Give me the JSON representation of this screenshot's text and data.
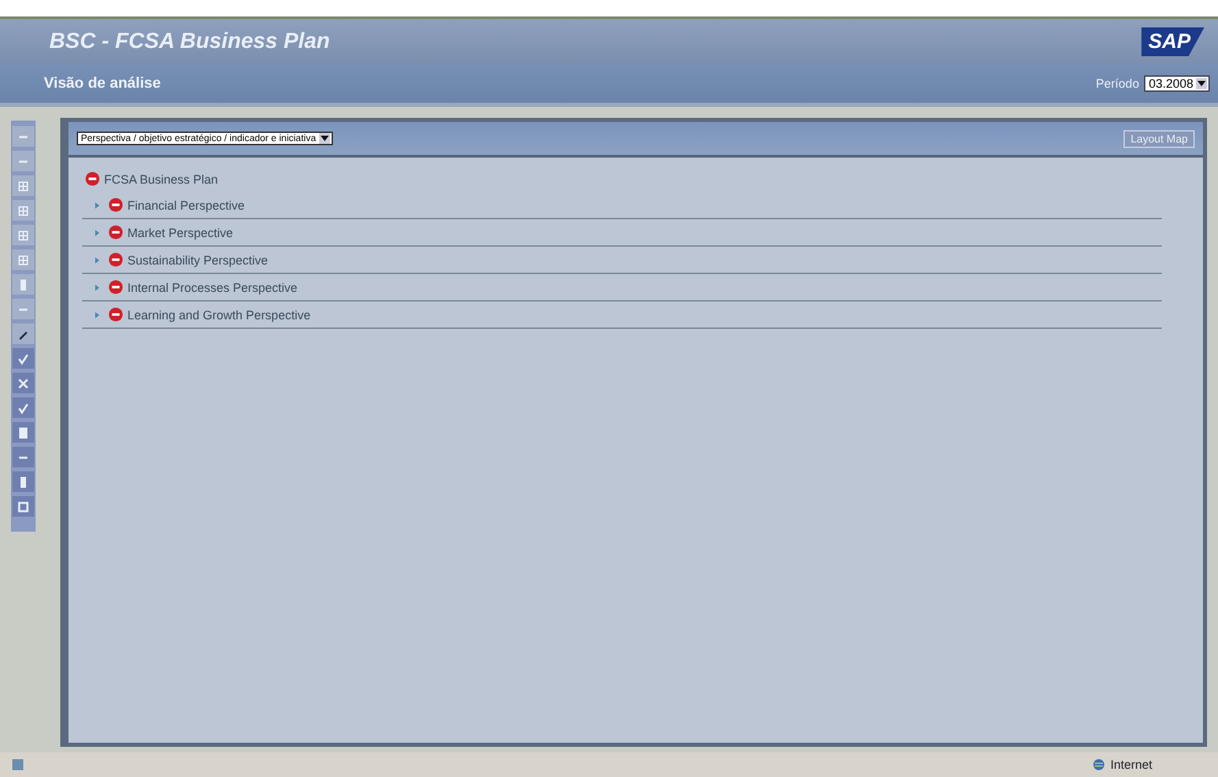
{
  "window": {
    "title": "BSC - FCSA Business Plan",
    "logo": "SAP"
  },
  "header": {
    "view_title": "Visão de análise",
    "period_label": "Período",
    "period_value": "03.2008"
  },
  "toolbar": [
    {
      "kind": "line"
    },
    {
      "kind": "line"
    },
    {
      "kind": "grid"
    },
    {
      "kind": "grid"
    },
    {
      "kind": "grid"
    },
    {
      "kind": "grid"
    },
    {
      "kind": "bar"
    },
    {
      "kind": "line"
    },
    {
      "kind": "pen"
    },
    {
      "kind": "check"
    },
    {
      "kind": "cross"
    },
    {
      "kind": "check"
    },
    {
      "kind": "doc"
    },
    {
      "kind": "line"
    },
    {
      "kind": "bar"
    },
    {
      "kind": "square"
    }
  ],
  "panel": {
    "hierarchy_select": "Perspectiva / objetivo estratégico / indicador e iniciativa",
    "layout_button": "Layout Map",
    "tree": {
      "label": "FCSA Business Plan",
      "color": "#d0202a",
      "children": [
        {
          "label": "Financial Perspective",
          "color": "#d0202a",
          "expanded": false
        },
        {
          "label": "Market Perspective",
          "color": "#d0202a",
          "expanded": false
        },
        {
          "label": "Sustainability Perspective",
          "color": "#d0202a",
          "expanded": false
        },
        {
          "label": "Internal Processes Perspective",
          "color": "#d0202a",
          "expanded": false
        },
        {
          "label": "Learning and Growth Perspective",
          "color": "#d0202a",
          "expanded": false
        }
      ]
    }
  },
  "status_bar": {
    "zone": "Internet"
  }
}
